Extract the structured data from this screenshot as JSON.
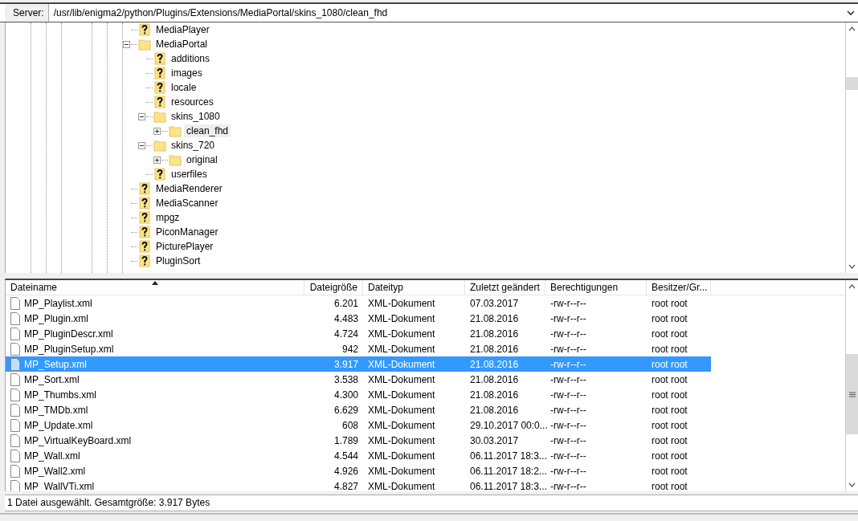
{
  "server_bar": {
    "label": "Server:",
    "path": "/usr/lib/enigma2/python/Plugins/Extensions/MediaPortal/skins_1080/clean_fhd"
  },
  "tree": [
    {
      "name": "MediaPlayer",
      "kind": "unknown",
      "selected": false
    },
    {
      "name": "MediaPortal",
      "kind": "folder",
      "selected": false,
      "expanded": true,
      "children": [
        {
          "name": "additions",
          "kind": "unknown",
          "selected": false
        },
        {
          "name": "images",
          "kind": "unknown",
          "selected": false
        },
        {
          "name": "locale",
          "kind": "unknown",
          "selected": false
        },
        {
          "name": "resources",
          "kind": "unknown",
          "selected": false
        },
        {
          "name": "skins_1080",
          "kind": "folder",
          "selected": false,
          "expanded": true,
          "children": [
            {
              "name": "clean_fhd",
              "kind": "folder",
              "selected": true,
              "expanded": false
            }
          ]
        },
        {
          "name": "skins_720",
          "kind": "folder",
          "selected": false,
          "expanded": true,
          "children": [
            {
              "name": "original",
              "kind": "folder",
              "selected": false,
              "expanded": false
            }
          ]
        },
        {
          "name": "userfiles",
          "kind": "unknown",
          "selected": false
        }
      ]
    },
    {
      "name": "MediaRenderer",
      "kind": "unknown",
      "selected": false
    },
    {
      "name": "MediaScanner",
      "kind": "unknown",
      "selected": false
    },
    {
      "name": "mpgz",
      "kind": "unknown",
      "selected": false
    },
    {
      "name": "PiconManager",
      "kind": "unknown",
      "selected": false
    },
    {
      "name": "PicturePlayer",
      "kind": "unknown",
      "selected": false
    },
    {
      "name": "PluginSort",
      "kind": "unknown",
      "selected": false
    }
  ],
  "table": {
    "columns": [
      "Dateiname",
      "Dateigröße",
      "Dateityp",
      "Zuletzt geändert",
      "Berechtigungen",
      "Besitzer/Gr..."
    ],
    "rows": [
      {
        "cells": [
          "MP_Playlist.xml",
          "6.201",
          "XML-Dokument",
          "07.03.2017",
          "-rw-r--r--",
          "root root"
        ],
        "selected": false
      },
      {
        "cells": [
          "MP_Plugin.xml",
          "4.483",
          "XML-Dokument",
          "21.08.2016",
          "-rw-r--r--",
          "root root"
        ],
        "selected": false
      },
      {
        "cells": [
          "MP_PluginDescr.xml",
          "4.724",
          "XML-Dokument",
          "21.08.2016",
          "-rw-r--r--",
          "root root"
        ],
        "selected": false
      },
      {
        "cells": [
          "MP_PluginSetup.xml",
          "942",
          "XML-Dokument",
          "21.08.2016",
          "-rw-r--r--",
          "root root"
        ],
        "selected": false
      },
      {
        "cells": [
          "MP_Setup.xml",
          "3.917",
          "XML-Dokument",
          "21.08.2016",
          "-rw-r--r--",
          "root root"
        ],
        "selected": true
      },
      {
        "cells": [
          "MP_Sort.xml",
          "3.538",
          "XML-Dokument",
          "21.08.2016",
          "-rw-r--r--",
          "root root"
        ],
        "selected": false
      },
      {
        "cells": [
          "MP_Thumbs.xml",
          "4.300",
          "XML-Dokument",
          "21.08.2016",
          "-rw-r--r--",
          "root root"
        ],
        "selected": false
      },
      {
        "cells": [
          "MP_TMDb.xml",
          "6.629",
          "XML-Dokument",
          "21.08.2016",
          "-rw-r--r--",
          "root root"
        ],
        "selected": false
      },
      {
        "cells": [
          "MP_Update.xml",
          "608",
          "XML-Dokument",
          "29.10.2017 00:0...",
          "-rw-r--r--",
          "root root"
        ],
        "selected": false
      },
      {
        "cells": [
          "MP_VirtualKeyBoard.xml",
          "1.789",
          "XML-Dokument",
          "30.03.2017",
          "-rw-r--r--",
          "root root"
        ],
        "selected": false
      },
      {
        "cells": [
          "MP_Wall.xml",
          "4.544",
          "XML-Dokument",
          "06.11.2017 18:3...",
          "-rw-r--r--",
          "root root"
        ],
        "selected": false
      },
      {
        "cells": [
          "MP_Wall2.xml",
          "4.926",
          "XML-Dokument",
          "06.11.2017 18:2...",
          "-rw-r--r--",
          "root root"
        ],
        "selected": false
      },
      {
        "cells": [
          "MP_WallVTi.xml",
          "4.827",
          "XML-Dokument",
          "06.11.2017 18:3...",
          "-rw-r--r--",
          "root root"
        ],
        "selected": false
      }
    ]
  },
  "status_bar": "1 Datei ausgewählt. Gesamtgröße: 3.917 Bytes"
}
